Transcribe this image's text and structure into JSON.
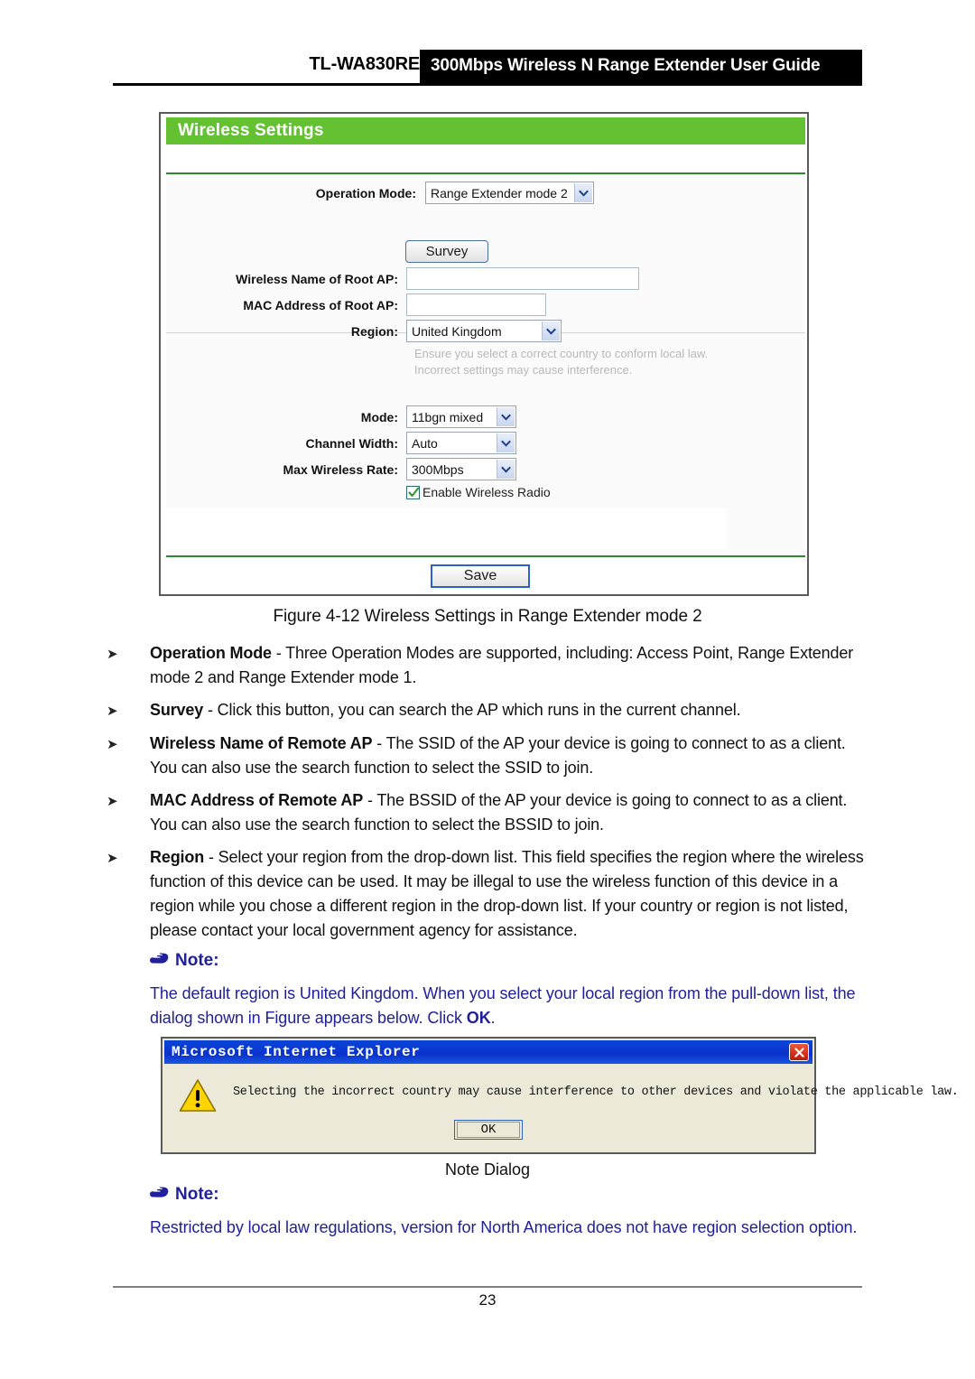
{
  "header": {
    "model": "TL-WA830RE",
    "title": "300Mbps Wireless N Range Extender User Guide"
  },
  "router_ui": {
    "panel_title": "Wireless Settings",
    "accent_color": "#63c132",
    "operation_mode": {
      "label": "Operation Mode:",
      "value": "Range Extender mode 2"
    },
    "survey_button": "Survey",
    "wireless_name": {
      "label": "Wireless Name of Root AP:",
      "value": ""
    },
    "mac_address": {
      "label": "MAC Address of Root AP:",
      "value": ""
    },
    "region": {
      "label": "Region:",
      "value": "United Kingdom",
      "hint_line1": "Ensure you select a correct country to conform local law.",
      "hint_line2": "Incorrect settings may cause interference."
    },
    "mode": {
      "label": "Mode:",
      "value": "11bgn mixed"
    },
    "channel_width": {
      "label": "Channel Width:",
      "value": "Auto"
    },
    "max_wireless_rate": {
      "label": "Max Wireless Rate:",
      "value": "300Mbps"
    },
    "enable_radio": {
      "label": "Enable Wireless Radio",
      "checked": true
    },
    "save_button": "Save"
  },
  "figure_caption": "Figure 4-12 Wireless Settings in Range Extender mode 2",
  "bullets": [
    {
      "term": "Operation Mode",
      "text": " - Three Operation Modes are supported, including: Access Point, Range Extender mode 2 and Range Extender mode 1."
    },
    {
      "term": "Survey",
      "text": " - Click this button, you can search the AP which runs in the current channel."
    },
    {
      "term": "Wireless Name of Remote AP",
      "text": " - The SSID of the AP your device is going to connect to as a client. You can also use the search function to select the SSID to join."
    },
    {
      "term": "MAC Address of Remote AP",
      "text": " - The BSSID of the AP your device is going to connect to as a client. You can also use the search function to select the BSSID to join."
    },
    {
      "term": "Region",
      "text": " - Select your region from the drop-down list. This field specifies the region where the wireless function of this device can be used. It may be illegal to use the wireless function of this device in a region while you chose a different region in the drop-down list. If your country or region is not listed, please contact your local government agency for assistance."
    }
  ],
  "note1": {
    "heading": "Note:",
    "text_part1": "The default region is United Kingdom. When you select your local region from the pull-down list, the dialog shown in Figure appears below. Click ",
    "text_bold": "OK",
    "text_part2": "."
  },
  "ie_dialog": {
    "title": "Microsoft Internet Explorer",
    "message": "Selecting the incorrect country may cause interference to other devices and violate the applicable law.",
    "ok_button": "OK",
    "title_color": "#0a32cc",
    "close_color": "#d52f1a",
    "warning_color": "#ffd400"
  },
  "note_dialog_caption": "Note Dialog",
  "note2": {
    "heading": "Note:",
    "text": "Restricted by local law regulations, version for North America does not have region selection option."
  },
  "footer": {
    "page_number": "23"
  },
  "note_color": "#20209c"
}
